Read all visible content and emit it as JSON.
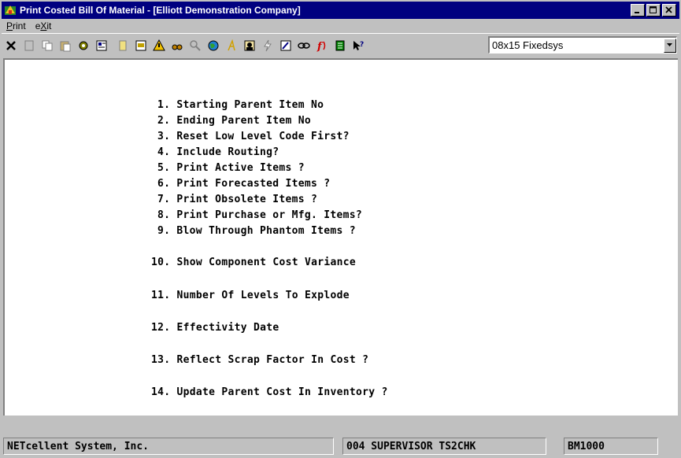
{
  "window": {
    "title": "Print Costed Bill Of Material - [Elliott Demonstration Company]"
  },
  "menu": {
    "items": [
      {
        "label": "Print",
        "underline": "P",
        "rest": "rint"
      },
      {
        "label": "eXit",
        "pre": "e",
        "underline": "X",
        "rest": "it"
      }
    ]
  },
  "toolbar": {
    "font_select_value": "08x15 Fixedsys",
    "icons": [
      "close-x-icon",
      "blank-icon",
      "copy-icon",
      "paste-icon",
      "gear-icon",
      "properties-icon",
      "note-icon",
      "print-setup-icon",
      "warning-icon",
      "binoculars-icon",
      "search-icon",
      "globe-icon",
      "italic-a-icon",
      "person-icon",
      "lightning-icon",
      "edit-icon",
      "link-icon",
      "function-icon",
      "list-icon",
      "help-pointer-icon"
    ]
  },
  "fields": [
    "1. Starting Parent Item No",
    "2. Ending Parent Item No",
    "3. Reset Low Level Code First?",
    "4. Include Routing?",
    "5. Print Active Items ?",
    "6. Print Forecasted Items ?",
    "7. Print Obsolete Items ?",
    "8. Print Purchase or Mfg. Items?",
    "9. Blow Through Phantom Items ?",
    "10. Show Component Cost Variance",
    "11. Number Of Levels To Explode",
    "12. Effectivity Date",
    "13. Reflect Scrap Factor In Cost ?",
    "14. Update Parent Cost In Inventory ?"
  ],
  "status": {
    "company": "NETcellent System, Inc.",
    "user": "004 SUPERVISOR TS2CHK",
    "program": "BM1000"
  },
  "colors": {
    "titlebar": "#000080",
    "window_bg": "#c0c0c0",
    "content_bg": "#ffffff"
  }
}
